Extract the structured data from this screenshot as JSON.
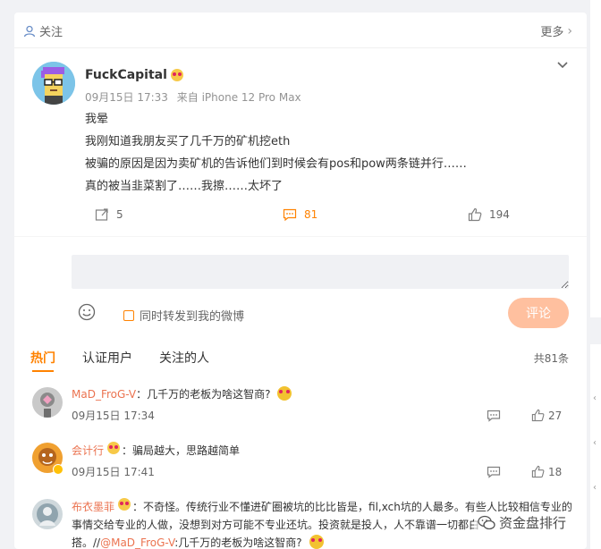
{
  "header": {
    "follow_label": "关注",
    "more_label": "更多"
  },
  "post": {
    "author": "FuckCapital",
    "date": "09月15日 17:33",
    "source": "来自 iPhone 12 Pro Max",
    "lines": [
      "我晕",
      "我刚知道我朋友买了几千万的矿机挖eth",
      "被骗的原因是因为卖矿机的告诉他们到时候会有pos和pow两条链并行……",
      "真的被当韭菜割了……我擦……太坏了"
    ],
    "repost_count": "5",
    "comment_count": "81",
    "like_count": "194"
  },
  "composer": {
    "placeholder": "",
    "repost_label": "同时转发到我的微博",
    "submit_label": "评论"
  },
  "tabs": {
    "items": [
      "热门",
      "认证用户",
      "关注的人"
    ],
    "total": "共81条"
  },
  "comments": [
    {
      "name": "MaD_FroG-V",
      "text": "：几千万的老板为啥这智商?",
      "time": "09月15日 17:34",
      "likes": "27"
    },
    {
      "name": "会计行",
      "text": "：骗局越大，思路越简单",
      "time": "09月15日 17:41",
      "likes": "18"
    },
    {
      "name": "布衣墨菲",
      "text_line1": "：不奇怪。传统行业不懂进矿圈被坑的比比皆是，fil,xch坑的人最多。有些人比较相信专业的",
      "text_line2": "事情交给专业的人做，没想到对方可能不专业还坑。投资就是投人，人不靠谱一切都白",
      "text_line3_prefix": "搭。//",
      "mention": "@MaD_FroG-V",
      "text_line3_suffix": ":几千万的老板为啥这智商?"
    }
  ],
  "watermark": {
    "text": "资金盘排行"
  },
  "colors": {
    "accent": "#ff8200",
    "name": "#eb7350",
    "submit_disabled": "#ffc09f"
  }
}
